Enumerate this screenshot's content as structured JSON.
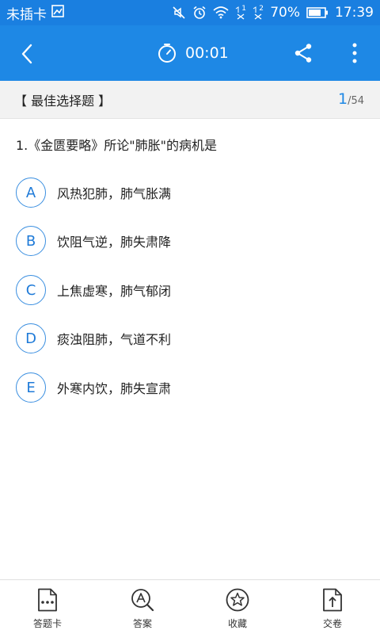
{
  "status_bar": {
    "carrier": "未插卡",
    "sim1_tag": "1",
    "sim2_tag": "2",
    "battery": "70%",
    "time": "17:39"
  },
  "header": {
    "timer": "00:01"
  },
  "section": {
    "title": "【 最佳选择题 】",
    "current": "1",
    "total": "/54"
  },
  "question": {
    "text": "1.《金匮要略》所论\"肺胀\"的病机是",
    "options": [
      {
        "letter": "A",
        "text": "风热犯肺，肺气胀满"
      },
      {
        "letter": "B",
        "text": "饮阻气逆，肺失肃降"
      },
      {
        "letter": "C",
        "text": "上焦虚寒，肺气郁闭"
      },
      {
        "letter": "D",
        "text": "痰浊阻肺，气道不利"
      },
      {
        "letter": "E",
        "text": "外寒内饮，肺失宣肃"
      }
    ]
  },
  "bottom_tabs": [
    {
      "label": "答题卡",
      "icon": "answer-sheet-icon"
    },
    {
      "label": "答案",
      "icon": "answer-search-icon"
    },
    {
      "label": "收藏",
      "icon": "star-icon"
    },
    {
      "label": "交卷",
      "icon": "submit-icon"
    }
  ],
  "colors": {
    "status_bar": "#1a7fe0",
    "app_bar": "#1e88e5",
    "accent": "#1e88e5"
  }
}
